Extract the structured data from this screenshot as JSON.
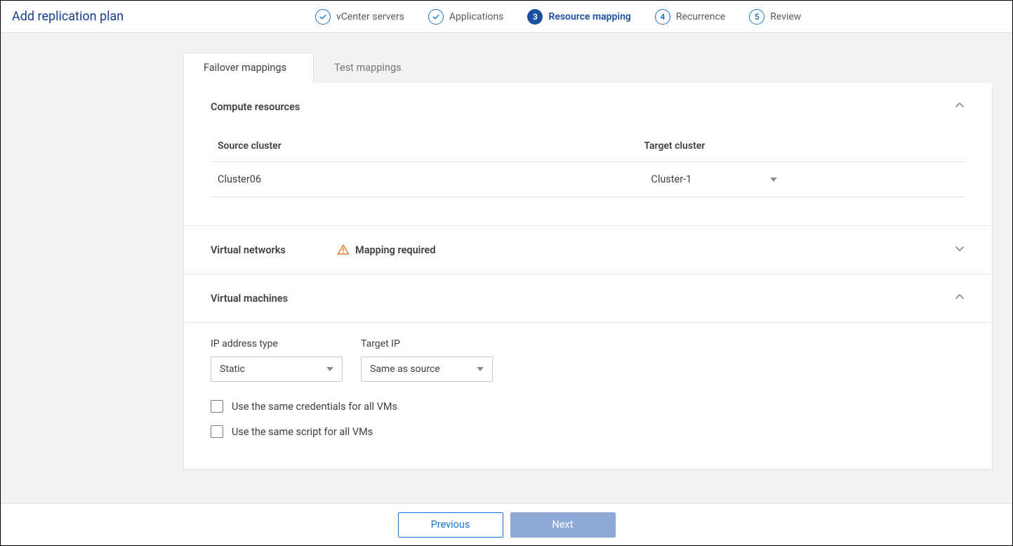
{
  "header": {
    "title": "Add replication plan",
    "steps": [
      {
        "label": "vCenter servers",
        "state": "done"
      },
      {
        "label": "Applications",
        "state": "done"
      },
      {
        "label": "Resource mapping",
        "state": "active",
        "num": "3"
      },
      {
        "label": "Recurrence",
        "state": "pending",
        "num": "4"
      },
      {
        "label": "Review",
        "state": "pending",
        "num": "5"
      }
    ]
  },
  "tabs": {
    "failover": "Failover mappings",
    "test": "Test mappings"
  },
  "compute": {
    "title": "Compute resources",
    "col_source": "Source cluster",
    "col_target": "Target cluster",
    "rows": [
      {
        "source": "Cluster06",
        "target": "Cluster-1"
      }
    ]
  },
  "networks": {
    "title": "Virtual networks",
    "warning": "Mapping required"
  },
  "vms": {
    "title": "Virtual machines",
    "ip_label": "IP address type",
    "ip_value": "Static",
    "target_label": "Target IP",
    "target_value": "Same as source",
    "cb_creds": "Use the same credentials for all VMs",
    "cb_script": "Use the same script for all VMs"
  },
  "footer": {
    "prev": "Previous",
    "next": "Next"
  }
}
